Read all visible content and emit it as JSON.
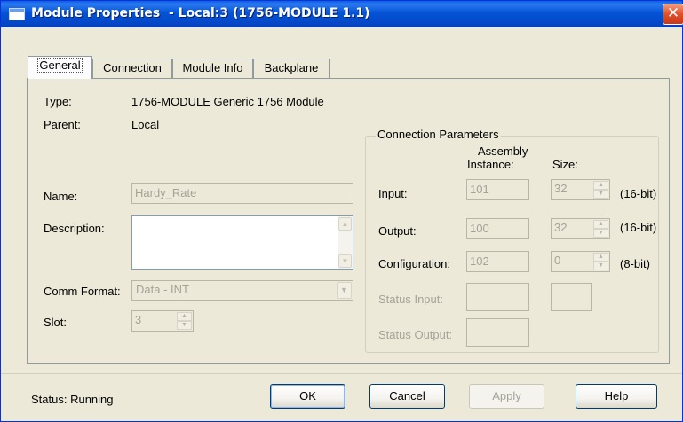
{
  "window": {
    "title": "Module Properties  - Local:3 (1756-MODULE 1.1)",
    "close_glyph": "✕"
  },
  "tabs": [
    {
      "label": "General",
      "selected": true
    },
    {
      "label": "Connection",
      "selected": false
    },
    {
      "label": "Module Info",
      "selected": false
    },
    {
      "label": "Backplane",
      "selected": false
    }
  ],
  "general": {
    "type_label": "Type:",
    "type_value": "1756-MODULE Generic 1756 Module",
    "parent_label": "Parent:",
    "parent_value": "Local",
    "name_label": "Name:",
    "name_value": "Hardy_Rate",
    "description_label": "Description:",
    "description_value": "",
    "comm_format_label": "Comm Format:",
    "comm_format_value": "Data - INT",
    "slot_label": "Slot:",
    "slot_value": "3"
  },
  "connection_parameters": {
    "title": "Connection Parameters",
    "col_assembly": "Assembly",
    "col_instance": "Instance:",
    "col_size": "Size:",
    "input": {
      "label": "Input:",
      "instance": "101",
      "size": "32",
      "unit": "(16-bit)"
    },
    "output": {
      "label": "Output:",
      "instance": "100",
      "size": "32",
      "unit": "(16-bit)"
    },
    "configuration": {
      "label": "Configuration:",
      "instance": "102",
      "size": "0",
      "unit": "(8-bit)"
    },
    "status_input": {
      "label": "Status Input:",
      "instance": "",
      "size": ""
    },
    "status_output": {
      "label": "Status Output:",
      "instance": ""
    }
  },
  "status": {
    "text": "Status:  Running"
  },
  "buttons": {
    "ok": "OK",
    "cancel": "Cancel",
    "apply": "Apply",
    "help": "Help"
  },
  "colors": {
    "titlebar": "#0553d6",
    "dialog_bg": "#ece9d8",
    "close": "#e0502a",
    "disabled_text": "#a5a398"
  }
}
